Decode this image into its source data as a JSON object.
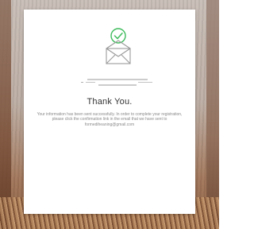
{
  "dialog": {
    "title": "Thank You.",
    "message": "Your information has been sent successfully. In order to complete your registration, please click the confirmation link in the email that we have sent to formediheaning@gmail.com"
  },
  "icons": {
    "status": "envelope-checkmark-icon"
  },
  "colors": {
    "accent": "#3dbb5b",
    "icon_line": "#9a9a9a",
    "title": "#333333",
    "message": "#8a8a8a",
    "card": "#ffffff"
  }
}
